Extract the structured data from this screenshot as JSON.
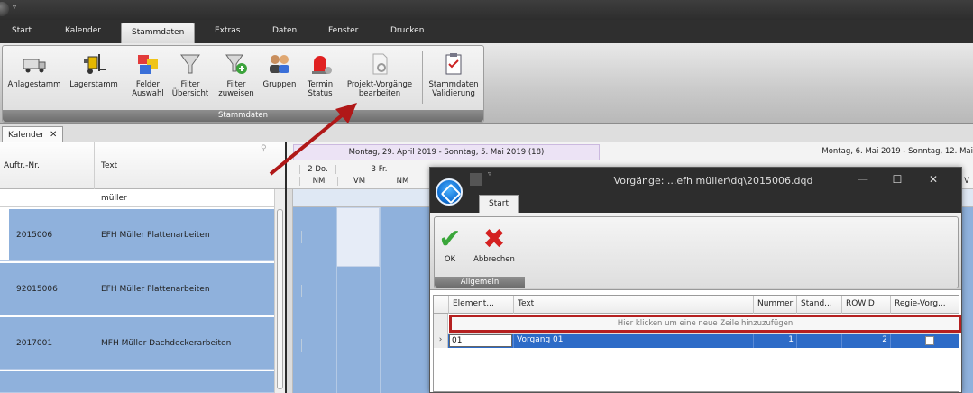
{
  "ribbon": {
    "tabs": [
      "Start",
      "Kalender",
      "Stammdaten",
      "Extras",
      "Daten",
      "Fenster",
      "Drucken"
    ],
    "active_tab": "Stammdaten",
    "group_label": "Stammdaten",
    "buttons": [
      {
        "label1": "Anlagestamm",
        "label2": "",
        "icon": "truck-icon"
      },
      {
        "label1": "Lagerstamm",
        "label2": "",
        "icon": "forklift-icon"
      },
      {
        "label1": "Felder",
        "label2": "Auswahl",
        "icon": "fields-icon"
      },
      {
        "label1": "Filter",
        "label2": "Übersicht",
        "icon": "filter-icon"
      },
      {
        "label1": "Filter",
        "label2": "zuweisen",
        "icon": "filter-assign-icon"
      },
      {
        "label1": "Gruppen",
        "label2": "",
        "icon": "group-icon"
      },
      {
        "label1": "Termin",
        "label2": "Status",
        "icon": "alarm-icon"
      },
      {
        "label1": "Projekt-Vorgänge",
        "label2": "bearbeiten",
        "icon": "document-gear-icon"
      },
      {
        "label1": "Stammdaten",
        "label2": "Validierung",
        "icon": "checklist-icon"
      }
    ]
  },
  "doc_tab": {
    "label": "Kalender",
    "close": "✕"
  },
  "grid": {
    "col_auftr": "Auftr.-Nr.",
    "col_text": "Text",
    "filter_text": "müller",
    "rows": [
      {
        "nr": "2015006",
        "text": "EFH Müller Plattenarbeiten"
      },
      {
        "nr": "92015006",
        "text": "EFH Müller Plattenarbeiten"
      },
      {
        "nr": "2017001",
        "text": "MFH Müller Dachdeckerarbeiten"
      }
    ]
  },
  "calendar": {
    "week1": "Montag, 29. April 2019 - Sonntag, 5. Mai 2019 (18)",
    "week2": "Montag, 6. Mai 2019 - Sonntag, 12. Mai",
    "day1": "2 Do.",
    "day2": "3 Fr.",
    "slots": [
      "NM",
      "VM",
      "NM"
    ],
    "slot_right": "V"
  },
  "dialog": {
    "title": "Vorgänge: ...efh müller\\dq\\2015006.dqd",
    "tab": "Start",
    "ok": "OK",
    "cancel": "Abbrechen",
    "group_label": "Allgemein",
    "columns": [
      "Element...",
      "Text",
      "Nummer",
      "Stand...",
      "ROWID",
      "Regie-Vorg..."
    ],
    "new_row": "Hier klicken um eine neue Zeile hinzuzufügen",
    "row": {
      "element": "01",
      "text": "Vorgang 01",
      "nummer": "1",
      "stand": "",
      "rowid": "2"
    }
  }
}
